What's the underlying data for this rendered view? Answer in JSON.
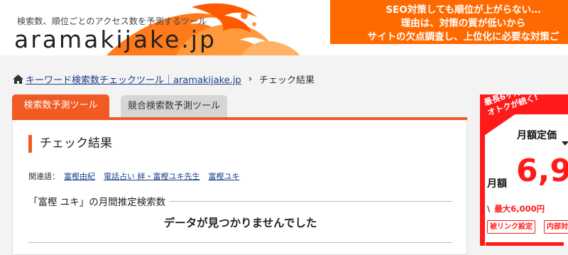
{
  "header": {
    "tagline": "検索数、順位ごとのアクセス数を予測するツール",
    "logo": "aramakijake.jp",
    "banner": {
      "line1": "SEO対策しても順位が上がらない…",
      "line2": "理由は、対策の質が低いから",
      "line3": "サイトの欠点調査し、上位化に必要な対策ご"
    }
  },
  "breadcrumb": {
    "home_link": "キーワード検索数チェックツール｜aramakijake.jp",
    "current": "チェック結果"
  },
  "tabs": [
    {
      "label": "検索数予測ツール",
      "active": true
    },
    {
      "label": "競合検索数予測ツール",
      "active": false
    }
  ],
  "result": {
    "title": "チェック結果",
    "related_label": "関連語：",
    "related": [
      "富樫由紀",
      "電話占い 絆・富樫ユキ先生",
      "富樫ユキ"
    ],
    "monthly_heading": "「富樫 ユキ」の月間推定検索数",
    "no_data": "データが見つかりませんでした"
  },
  "ad": {
    "badge_line1": "最長6ヶ月",
    "badge_line2": "オトクが続く!",
    "label": "月額定価",
    "getsu": "月額",
    "price": "6,9",
    "sub": "最大6,000円",
    "chip1": "被リンク設定",
    "chip2": "内部対",
    "slash": "\\"
  },
  "colors": {
    "accent": "#f15a22",
    "banner": "#ff6a00",
    "ad_red": "#ff1a1a",
    "link": "#1a3f8a"
  }
}
